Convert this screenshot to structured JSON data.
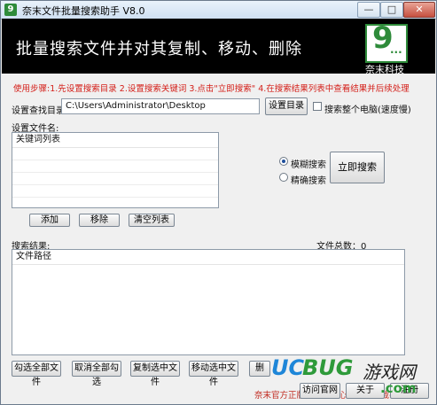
{
  "window": {
    "app_icon_glyph": "9",
    "title": "奈末文件批量搜索助手 V8.0",
    "minimize": "—",
    "maximize": "□",
    "close": "✕"
  },
  "banner": {
    "title": "批量搜索文件并对其复制、移动、删除",
    "logo_text": "9",
    "logo_dots": "...",
    "brand": "奈末科技"
  },
  "usage": "使用步骤:1.先设置搜索目录 2.设置搜索关键词 3.点击\"立即搜索\" 4.在搜索结果列表中查看结果并后续处理",
  "search_dir": {
    "label": "设置查找目录:",
    "value": "C:\\Users\\Administrator\\Desktop",
    "button": "设置目录",
    "whole_pc_label": "搜索整个电脑(速度慢)"
  },
  "file_names": {
    "label": "设置文件名:",
    "column": "关键词列表",
    "add": "添加",
    "remove": "移除",
    "clear": "清空列表"
  },
  "mode": {
    "fuzzy": "模糊搜索",
    "exact": "精确搜索",
    "search_button": "立即搜索"
  },
  "results": {
    "label": "搜索结果:",
    "total_label": "文件总数：0",
    "column": "文件路径"
  },
  "actions": {
    "select_all": "勾选全部文件",
    "deselect_all": "取消全部勾选",
    "copy": "复制选中文件",
    "move": "移动选中文件",
    "delete_partial": "删"
  },
  "footer": {
    "note": "奈末官方正版，安全放心，官方下载-->",
    "visit": "访问官网",
    "about": "关于",
    "register": "注册"
  },
  "watermark": {
    "uc": "UC",
    "bug": "BUG",
    "cn": "游戏网",
    "com": ".com"
  },
  "colors": {
    "banner_bg": "#000000",
    "usage_text": "#d4201a",
    "brand_green": "#2e8b3a"
  }
}
